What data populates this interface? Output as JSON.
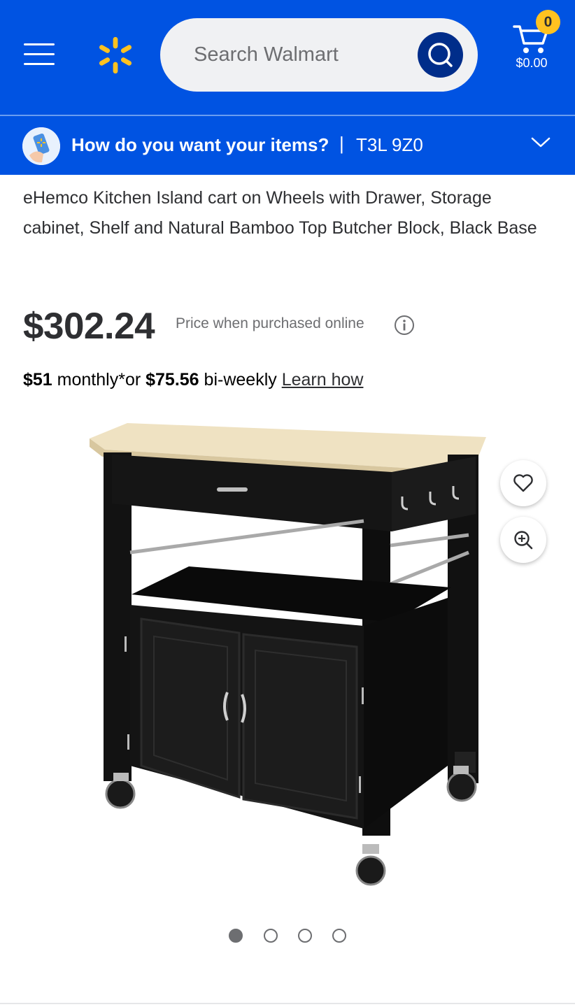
{
  "header": {
    "search_placeholder": "Search Walmart",
    "cart_count": "0",
    "cart_amount": "$0.00",
    "colors": {
      "brand_blue": "#0053e2",
      "spark_yellow": "#ffc220",
      "search_button": "#002d8a"
    },
    "icons": {
      "menu": "hamburger-menu-icon",
      "logo": "walmart-spark-logo",
      "search": "search-icon",
      "cart": "cart-icon"
    }
  },
  "delivery": {
    "question": "How do you want your items?",
    "separator": "|",
    "zip": "T3L 9Z0",
    "icon": "chevron-down-icon"
  },
  "product": {
    "title": "eHemco Kitchen Island cart on Wheels with Drawer, Storage cabinet, Shelf and Natural Bamboo Top Butcher Block, Black Base",
    "price": "$302.24",
    "price_note": "Price when purchased online",
    "financing": {
      "monthly_amount": "$51",
      "monthly_text": "monthly*or",
      "biweekly_amount": "$75.56",
      "biweekly_text": "bi-weekly",
      "link": "Learn how"
    },
    "image_actions": {
      "favorite": "heart-icon",
      "zoom": "zoom-in-icon"
    },
    "carousel": {
      "total": 4,
      "active": 1
    }
  }
}
